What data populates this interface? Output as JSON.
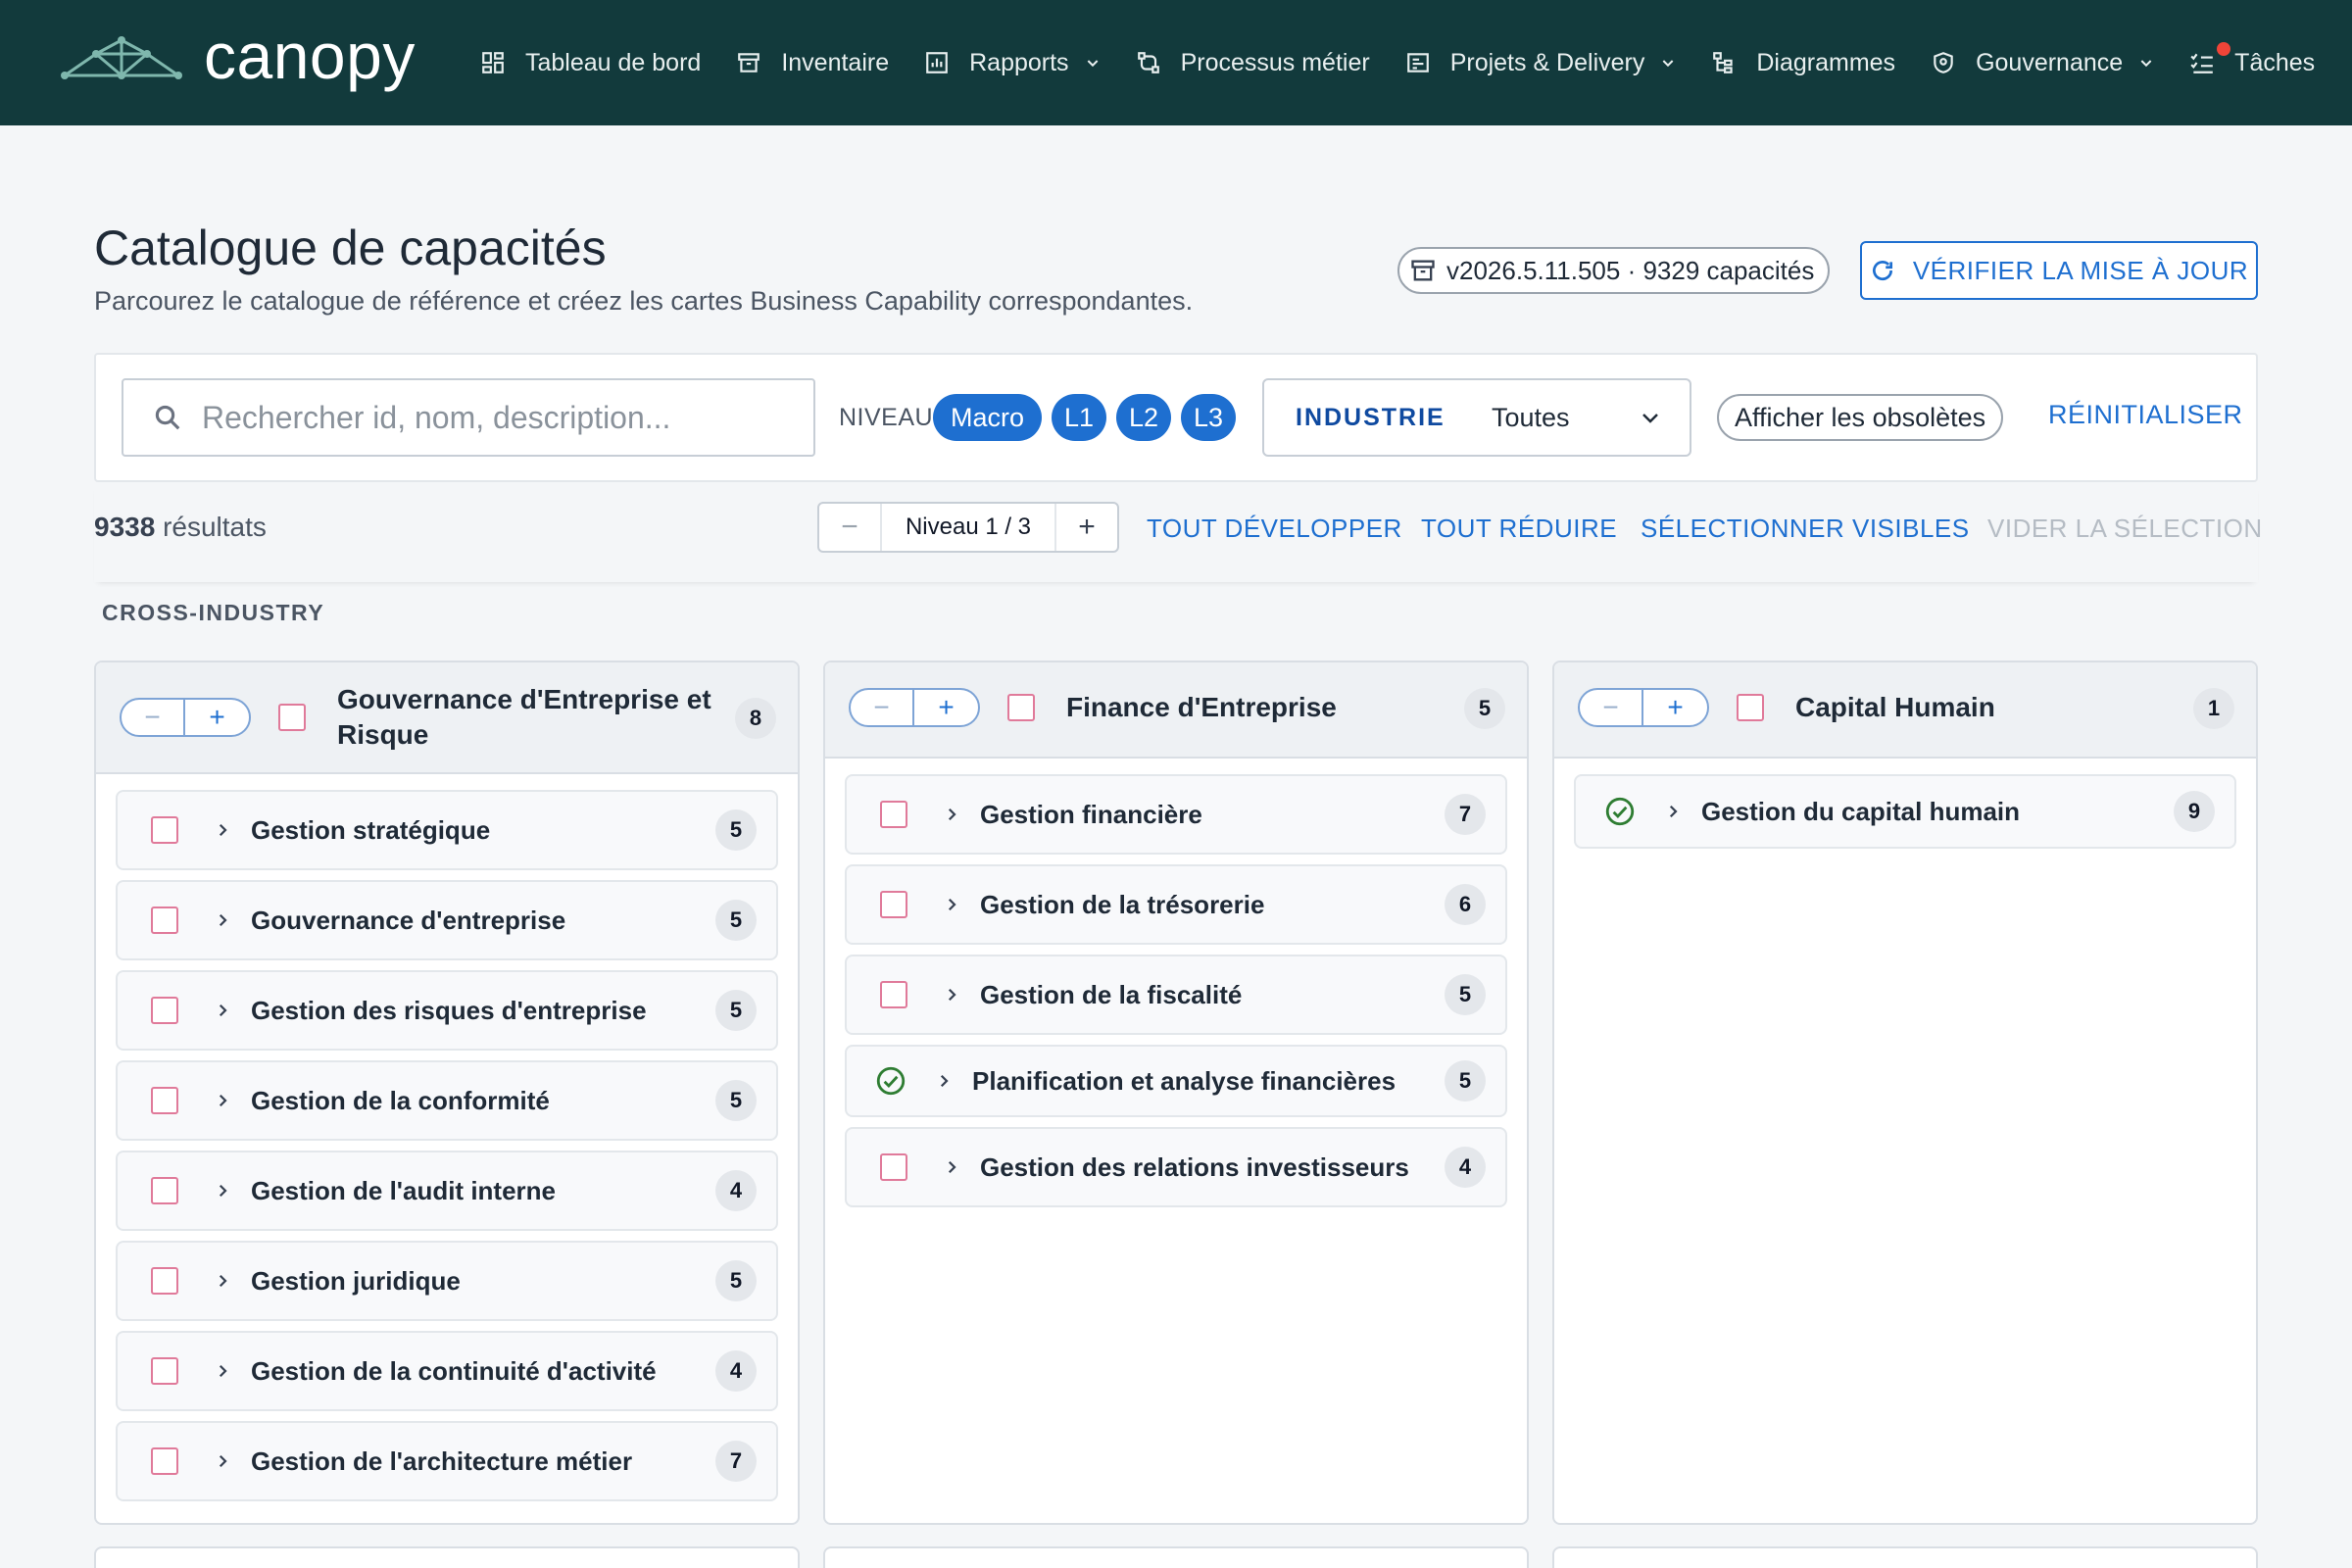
{
  "nav": {
    "brand": "canopy",
    "items": [
      {
        "label": "Tableau de bord",
        "icon": "dashboard-icon",
        "dropdown": false
      },
      {
        "label": "Inventaire",
        "icon": "archive-icon",
        "dropdown": false
      },
      {
        "label": "Rapports",
        "icon": "report-icon",
        "dropdown": true
      },
      {
        "label": "Processus métier",
        "icon": "process-icon",
        "dropdown": false
      },
      {
        "label": "Projets & Delivery",
        "icon": "project-icon",
        "dropdown": true
      },
      {
        "label": "Diagrammes",
        "icon": "diagram-icon",
        "dropdown": false
      },
      {
        "label": "Gouvernance",
        "icon": "shield-icon",
        "dropdown": true
      },
      {
        "label": "Tâches",
        "icon": "tasks-icon",
        "dropdown": false,
        "notification": true
      }
    ]
  },
  "header": {
    "title": "Catalogue de capacités",
    "subtitle": "Parcourez le catalogue de référence et créez les cartes Business Capability correspondantes.",
    "version_chip": "v2026.5.11.505 · 9329 capacités",
    "verify_button": "VÉRIFIER LA MISE À JOUR"
  },
  "filters": {
    "search_placeholder": "Rechercher id, nom, description...",
    "search_value": "",
    "level_label": "NIVEAU",
    "levels": [
      "Macro",
      "L1",
      "L2",
      "L3"
    ],
    "industry_label": "INDUSTRIE",
    "industry_value": "Toutes",
    "obsolete_toggle": "Afficher les obsolètes",
    "reset": "RÉINITIALISER"
  },
  "results": {
    "count": "9338",
    "count_suffix": " résultats",
    "level_stepper": "Niveau 1 / 3",
    "expand_all": "TOUT DÉVELOPPER",
    "collapse_all": "TOUT RÉDUIRE",
    "select_visible": "SÉLECTIONNER VISIBLES",
    "clear_selection": "VIDER LA SÉLECTION"
  },
  "section": "CROSS-INDUSTRY",
  "columns": [
    {
      "title_line1": "Gouvernance d'Entreprise et",
      "title_line2": "Risque",
      "count": "8",
      "items": [
        {
          "label": "Gestion stratégique",
          "count": "5",
          "status": "unchecked"
        },
        {
          "label": "Gouvernance d'entreprise",
          "count": "5",
          "status": "unchecked"
        },
        {
          "label": "Gestion des risques d'entreprise",
          "count": "5",
          "status": "unchecked"
        },
        {
          "label": "Gestion de la conformité",
          "count": "5",
          "status": "unchecked"
        },
        {
          "label": "Gestion de l'audit interne",
          "count": "4",
          "status": "unchecked"
        },
        {
          "label": "Gestion juridique",
          "count": "5",
          "status": "unchecked"
        },
        {
          "label": "Gestion de la continuité d'activité",
          "count": "4",
          "status": "unchecked"
        },
        {
          "label": "Gestion de l'architecture métier",
          "count": "7",
          "status": "unchecked"
        }
      ]
    },
    {
      "title_line1": "Finance d'Entreprise",
      "title_line2": "",
      "count": "5",
      "items": [
        {
          "label": "Gestion financière",
          "count": "7",
          "status": "unchecked"
        },
        {
          "label": "Gestion de la trésorerie",
          "count": "6",
          "status": "unchecked"
        },
        {
          "label": "Gestion de la fiscalité",
          "count": "5",
          "status": "unchecked"
        },
        {
          "label": "Planification et analyse financières",
          "count": "5",
          "status": "existing"
        },
        {
          "label": "Gestion des relations investisseurs",
          "count": "4",
          "status": "unchecked"
        }
      ]
    },
    {
      "title_line1": "Capital Humain",
      "title_line2": "",
      "count": "1",
      "items": [
        {
          "label": "Gestion du capital humain",
          "count": "9",
          "status": "existing"
        }
      ]
    }
  ],
  "colors": {
    "nav_bg": "#123a3c",
    "accent": "#1e6fd0",
    "checkbox_border": "#e07a9a",
    "success": "#2e7d32"
  }
}
